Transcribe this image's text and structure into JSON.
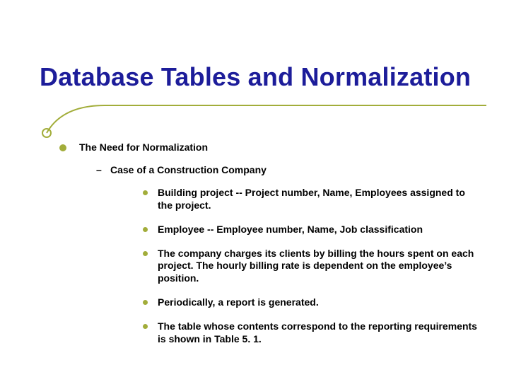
{
  "title": "Database Tables and Normalization",
  "lvl1": "The Need for Normalization",
  "lvl2": "Case of a Construction Company",
  "items": [
    "Building project -- Project number, Name, Employees assigned to the project.",
    "Employee -- Employee number, Name, Job classification",
    "The company charges its clients by billing the hours spent on each project. The hourly billing rate is dependent on the employee’s position.",
    "Periodically, a report is generated.",
    "The table whose contents correspond to the reporting requirements is shown in Table 5. 1."
  ]
}
